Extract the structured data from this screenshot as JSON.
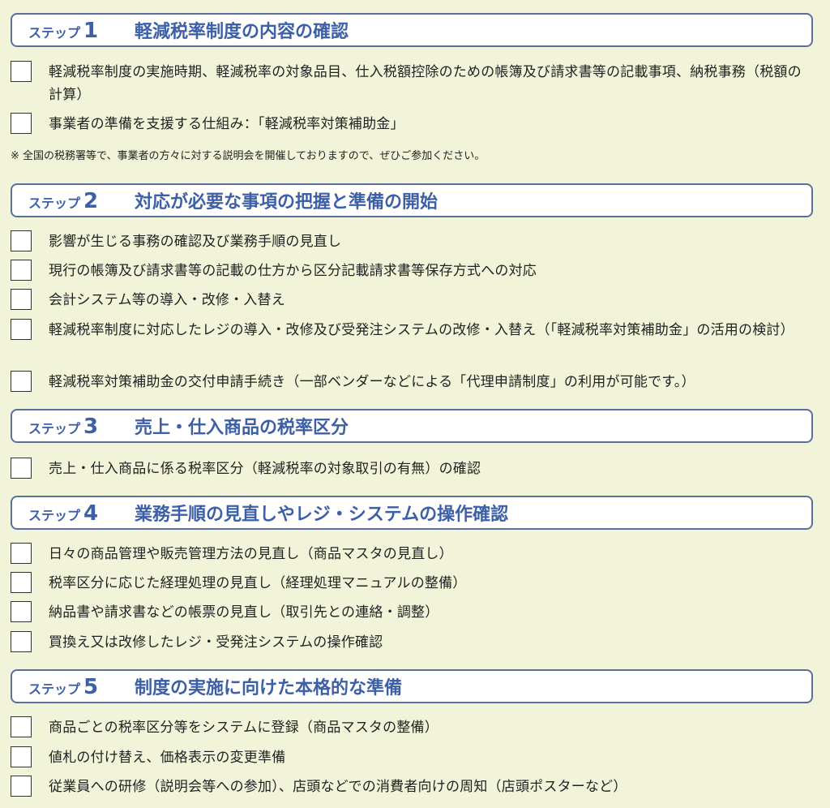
{
  "steps": [
    {
      "word": "ステップ",
      "number": "1",
      "title": "軽減税率制度の内容の確認",
      "items": [
        "軽減税率制度の実施時期、軽減税率の対象品目、仕入税額控除のための帳簿及び請求書等の記載事項、納税事務（税額の計算）",
        "事業者の準備を支援する仕組み：「軽減税率対策補助金」"
      ],
      "note": "※ 全国の税務署等で、事業者の方々に対する説明会を開催しておりますので、ぜひご参加ください。"
    },
    {
      "word": "ステップ",
      "number": "2",
      "title": "対応が必要な事項の把握と準備の開始",
      "items": [
        "影響が生じる事務の確認及び業務手順の見直し",
        "現行の帳簿及び請求書等の記載の仕方から区分記載請求書等保存方式への対応",
        "会計システム等の導入・改修・入替え",
        "軽減税率制度に対応したレジの導入・改修及び受発注システムの改修・入替え（「軽減税率対策補助金」の活用の検討）",
        "軽減税率対策補助金の交付申請手続き（一部ベンダーなどによる「代理申請制度」の利用が可能です。）"
      ]
    },
    {
      "word": "ステップ",
      "number": "3",
      "title": "売上・仕入商品の税率区分",
      "items": [
        "売上・仕入商品に係る税率区分（軽減税率の対象取引の有無）の確認"
      ]
    },
    {
      "word": "ステップ",
      "number": "4",
      "title": "業務手順の見直しやレジ・システムの操作確認",
      "items": [
        "日々の商品管理や販売管理方法の見直し（商品マスタの見直し）",
        "税率区分に応じた経理処理の見直し（経理処理マニュアルの整備）",
        "納品書や請求書などの帳票の見直し（取引先との連絡・調整）",
        "買換え又は改修したレジ・受発注システムの操作確認"
      ]
    },
    {
      "word": "ステップ",
      "number": "5",
      "title": "制度の実施に向けた本格的な準備",
      "items": [
        "商品ごとの税率区分等をシステムに登録（商品マスタの整備）",
        "値札の付け替え、価格表示の変更準備",
        "従業員への研修（説明会等への参加）、店頭などでの消費者向けの周知（店頭ポスターなど）"
      ]
    }
  ]
}
